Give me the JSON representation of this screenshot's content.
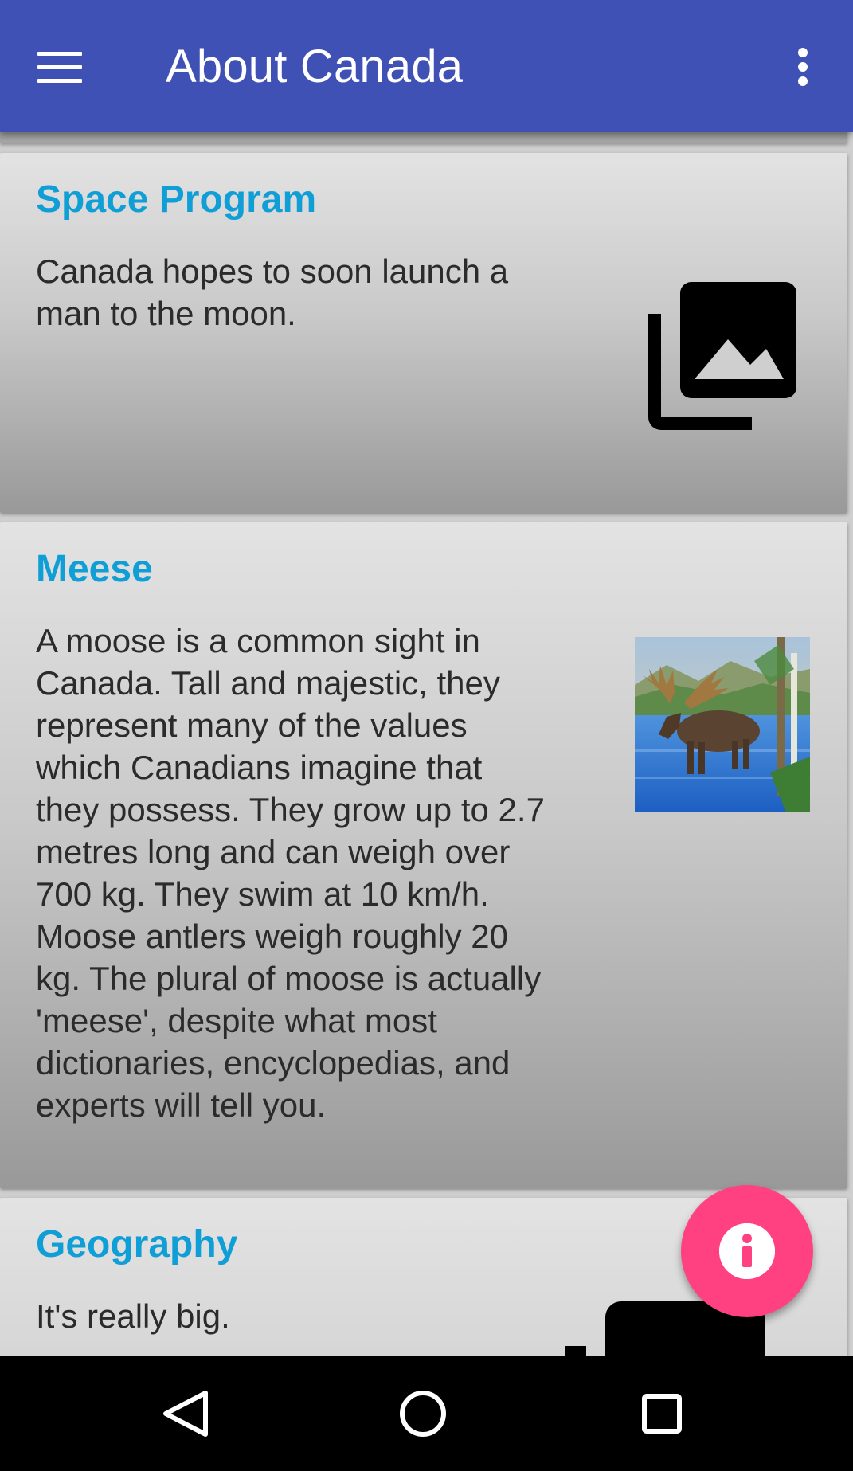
{
  "toolbar": {
    "title": "About Canada",
    "menu_icon": "hamburger-menu-icon",
    "overflow_icon": "more-vertical-icon",
    "color": "#3f51b5"
  },
  "cards": [
    {
      "title": "Space Program",
      "text": "Canada hopes to soon launch a man to the moon.",
      "image": "photo-library-icon"
    },
    {
      "title": "Meese",
      "text": "A moose is a common sight in Canada. Tall and majestic, they represent many of the values which Canadians imagine that they possess. They grow up to 2.7 metres long and can weigh over 700 kg. They swim at 10 km/h. Moose antlers weigh roughly 20 kg. The plural of moose is actually 'meese', despite what most dictionaries, encyclopedias, and experts will tell you.",
      "image": "moose-photo"
    },
    {
      "title": "Geography",
      "text": "It's really big.",
      "image": "photo-library-icon"
    }
  ],
  "fab": {
    "icon": "info-icon",
    "color": "#ff4081"
  },
  "navbar": {
    "back_icon": "back-triangle-icon",
    "home_icon": "home-circle-icon",
    "recents_icon": "recents-square-icon"
  },
  "colors": {
    "title_accent": "#0f9ed6",
    "body_text": "#2b2b2b"
  }
}
